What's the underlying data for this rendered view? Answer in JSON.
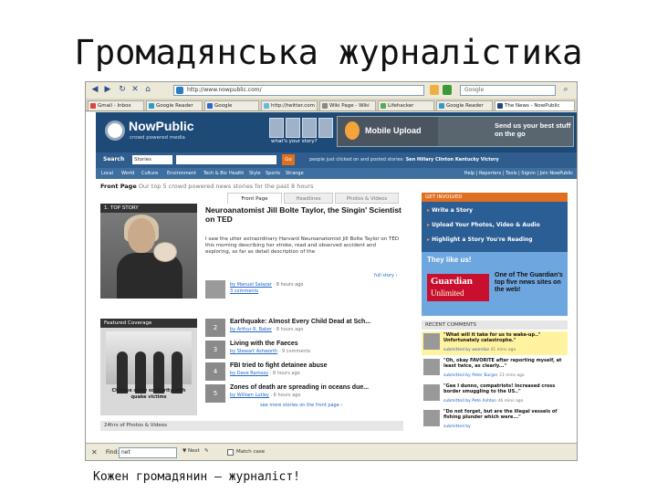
{
  "slide": {
    "title": "Громадянська журналістика",
    "caption": "Кожен громадянин – журналіст!"
  },
  "browser": {
    "url": "http://www.nowpublic.com/",
    "search_placeholder": "Google",
    "tabs": [
      {
        "label": "Gmail - Inbox"
      },
      {
        "label": "Google Reader"
      },
      {
        "label": "Google"
      },
      {
        "label": "http://twitter.com"
      },
      {
        "label": "Wiki Page - Wiki"
      },
      {
        "label": "Lifehacker"
      },
      {
        "label": "Google Reader"
      },
      {
        "label": "The News - NowPublic"
      }
    ],
    "find_label": "Find:",
    "find_value": "net",
    "find_next": "Next",
    "find_prev": "Previous",
    "highlight": "Highlight all",
    "match_case": "Match case"
  },
  "nowpublic": {
    "logo": "NowPublic",
    "tagline": "crowd powered media",
    "whats_story": "what's your story?",
    "banner_title": "Mobile Upload",
    "banner_text": "Send us your best stuff on the go",
    "search_label": "Search",
    "search_scope": "Stories",
    "search_go": "Go",
    "trend_prefix": "people just clicked on and posted stories:",
    "trend_topics": "Sen Hillary Clinton Kentucky Victory",
    "categories": [
      "Local",
      "World",
      "Culture",
      "Environment",
      "Tech & Biz",
      "Health",
      "Style",
      "Sports",
      "Strange"
    ],
    "account_links": "Help | Reporters | Tools | Signin | Join NowPublic",
    "front_page": "Front Page",
    "front_page_sub": "Our top 5 crowd powered news stories for the past 8 hours",
    "tabs": [
      "Front Page",
      "Headlines",
      "Photos & Videos"
    ],
    "top_story_label": "1. TOP STORY",
    "top_headline": "Neuroanatomist Jill Bolte Taylor, the Singin' Scientist on TED",
    "top_summary": "I saw the utter extraordinary Harvard Neuroanatomist Jill Bolte Taylor on TED this morning describing her stroke, read and observed accident and exploring, so far as detail description of the",
    "more": "full story ›",
    "byline_user": "by Manuel Salazar",
    "byline_time": "8 hours ago",
    "byline_votes": "3 comments",
    "featured_label": "Featured Coverage",
    "featured_caption": "Chinese show solidarity with quake victims",
    "stories": [
      {
        "num": "2",
        "headline": "Earthquake: Almost Every Child Dead at Sch...",
        "by": "by Arthur R. Baker",
        "time": "8 hours ago"
      },
      {
        "num": "3",
        "headline": "Living with the Faeces",
        "by": "by Stewart Ashworth",
        "time": "9 comments"
      },
      {
        "num": "4",
        "headline": "FBI tried to fight detainee abuse",
        "by": "by Dave Ramsay",
        "time": "8 hours ago"
      },
      {
        "num": "5",
        "headline": "Zones of death are spreading in oceans due...",
        "by": "by William Lutley",
        "time": "6 hours ago"
      }
    ],
    "see_more": "see more stories on the front page ›",
    "photos_bar": "24hrs of Photos & Videos",
    "get_involved": "GET INVOLVED",
    "involved": [
      "Write a Story",
      "Upload Your Photos, Video & Audio",
      "Highlight a Story You're Reading"
    ],
    "they_like": "They like us!",
    "guardian_1": "Guardian",
    "guardian_2": "Unlimited",
    "guardian_text": "One of The Guardian's top five news sites on the web!",
    "recent_comments": "RECENT COMMENTS",
    "comments": [
      {
        "text": "\"What will it take for us to wake-up..\" Unfortunately catastrophe.\"",
        "by": "submitted by wamdaz",
        "time": "41 mins ago"
      },
      {
        "text": "\"Oh, okay FAVORITE after reporting myself, at least twice, as clearly...\"",
        "by": "submitted by Peter Burger",
        "time": "21 mins ago"
      },
      {
        "text": "\"Gee I dunno, compatriots! Increased cross border smuggling to the US..\"",
        "by": "submitted by Pete Ashton",
        "time": "46 mins ago"
      },
      {
        "text": "\"Do not forget, but are the illegal vessels of fishing plunder which were...\"",
        "by": "submitted by",
        "time": ""
      }
    ]
  }
}
